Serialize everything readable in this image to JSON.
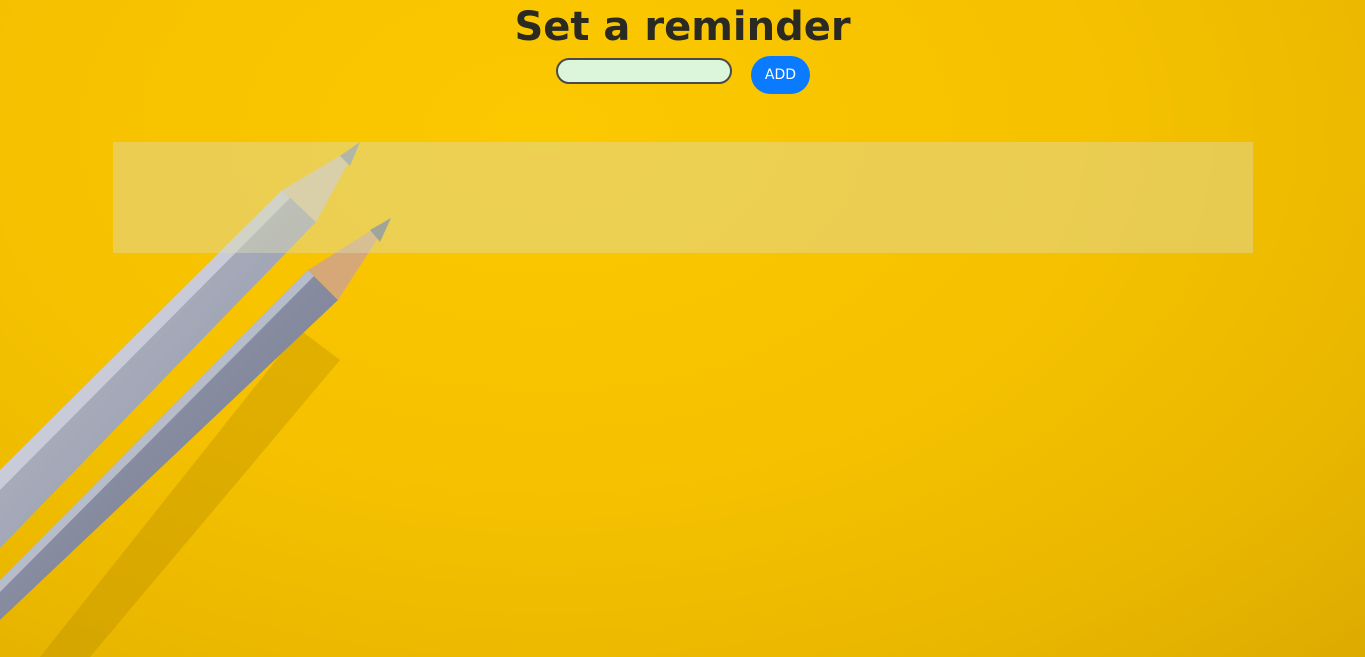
{
  "header": {
    "title": "Set a reminder"
  },
  "form": {
    "input_value": "",
    "input_placeholder": "",
    "add_label": "ADD"
  },
  "reminders": {
    "items": []
  },
  "background": {
    "image": "yellow-background-with-two-pencils",
    "colors": {
      "background": "#f6c200",
      "input_fill": "#dcf6dc",
      "button": "#0a7bff",
      "panel": "#e3d96a"
    }
  }
}
